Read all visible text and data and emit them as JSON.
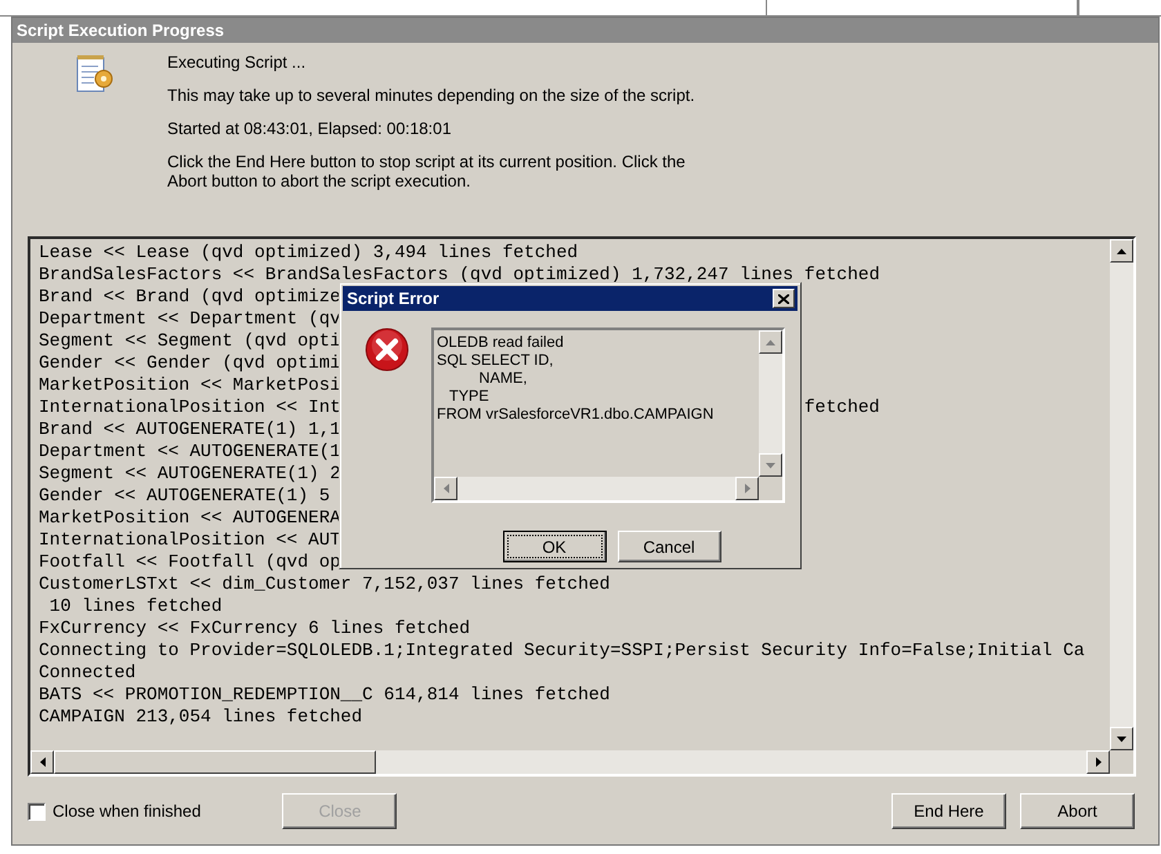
{
  "window": {
    "title": "Script Execution Progress"
  },
  "header": {
    "lines": [
      "Executing Script ...",
      "This may take up to several minutes depending on the size of the script.",
      "Started at 08:43:01, Elapsed: 00:18:01",
      "Click the End Here button to stop script at its current position. Click the Abort button to abort the script execution."
    ]
  },
  "log": {
    "lines": [
      {
        "text": "Lease << Lease (qvd optimized) 3,494 lines fetched"
      },
      {
        "text": "BrandSalesFactors << BrandSalesFactors (qvd optimized) 1,732,247 lines fetched"
      },
      {
        "text": "Brand << Brand (qvd optimize"
      },
      {
        "text": "Department << Department (qv"
      },
      {
        "text": "Segment << Segment (qvd opti"
      },
      {
        "text": "Gender << Gender (qvd optimi"
      },
      {
        "text": "MarketPosition << MarketPosi"
      },
      {
        "text": "InternationalPosition << Int",
        "tail": "fetched"
      },
      {
        "text": "Brand << AUTOGENERATE(1) 1,1"
      },
      {
        "text": "Department << AUTOGENERATE(1"
      },
      {
        "text": "Segment << AUTOGENERATE(1) 2"
      },
      {
        "text": "Gender << AUTOGENERATE(1) 5"
      },
      {
        "text": "MarketPosition << AUTOGENERA"
      },
      {
        "text": "InternationalPosition << AUT"
      },
      {
        "text": "Footfall << Footfall (qvd op"
      },
      {
        "text": "CustomerLSTxt << dim_Customer 7,152,037 lines fetched"
      },
      {
        "text": " 10 lines fetched"
      },
      {
        "text": "FxCurrency << FxCurrency 6 lines fetched"
      },
      {
        "text": "Connecting to Provider=SQLOLEDB.1;Integrated Security=SSPI;Persist Security Info=False;Initial Ca"
      },
      {
        "text": "Connected"
      },
      {
        "text": "BATS << PROMOTION_REDEMPTION__C 614,814 lines fetched"
      },
      {
        "text": "CAMPAIGN 213,054 lines fetched"
      }
    ]
  },
  "close_when_finished": {
    "label": "Close when finished",
    "checked": false
  },
  "close_button": {
    "label": "Close",
    "disabled": true
  },
  "action_buttons": [
    {
      "label": "End Here",
      "disabled": false
    },
    {
      "label": "Abort",
      "disabled": false
    }
  ],
  "error_dialog": {
    "title": "Script Error",
    "message": "OLEDB read failed\nSQL SELECT ID,\n          NAME,\n   TYPE\nFROM vrSalesforceVR1.dbo.CAMPAIGN",
    "buttons": [
      {
        "label": "OK",
        "focused": true
      },
      {
        "label": "Cancel",
        "focused": false
      }
    ]
  }
}
